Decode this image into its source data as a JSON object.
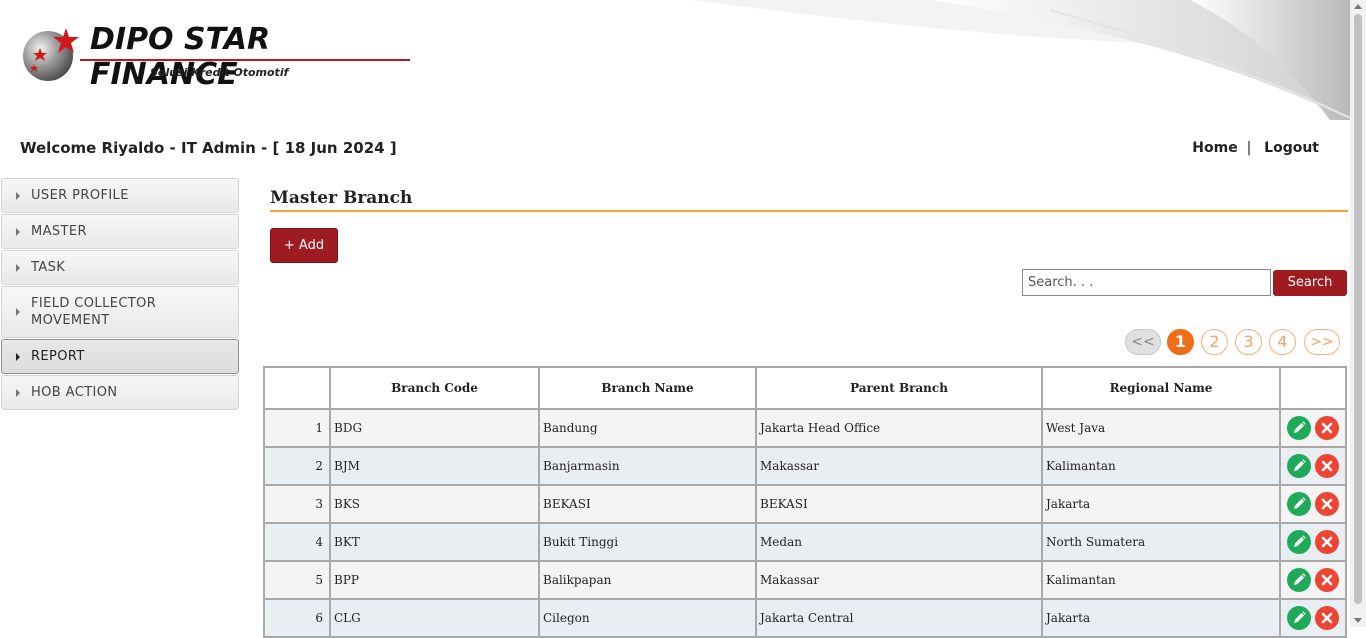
{
  "brand": {
    "name": "DIPO STAR FINANCE",
    "tagline": "Solusi Kredit Otomotif"
  },
  "header": {
    "welcome": "Welcome Riyaldo - IT Admin - [ 18 Jun 2024 ]",
    "links": {
      "home": "Home",
      "separator": "|",
      "logout": "Logout"
    }
  },
  "sidebar": {
    "items": [
      {
        "label": "USER PROFILE"
      },
      {
        "label": "MASTER"
      },
      {
        "label": "TASK"
      },
      {
        "label": "FIELD COLLECTOR MOVEMENT"
      },
      {
        "label": "REPORT"
      },
      {
        "label": "HOB ACTION"
      }
    ],
    "active": "REPORT"
  },
  "main": {
    "title": "Master Branch",
    "add_label": "+ Add",
    "search": {
      "placeholder": "Search. . .",
      "value": "",
      "button": "Search"
    },
    "pagination": {
      "prev": "<<",
      "pages": [
        "1",
        "2",
        "3",
        "4"
      ],
      "current": "1",
      "next": ">>"
    },
    "table": {
      "columns": [
        "",
        "Branch Code",
        "Branch Name",
        "Parent Branch",
        "Regional Name",
        ""
      ],
      "rows": [
        {
          "no": "1",
          "code": "BDG",
          "name": "Bandung",
          "parent": "Jakarta Head Office",
          "regional": "West Java"
        },
        {
          "no": "2",
          "code": "BJM",
          "name": "Banjarmasin",
          "parent": "Makassar",
          "regional": "Kalimantan"
        },
        {
          "no": "3",
          "code": "BKS",
          "name": "BEKASI",
          "parent": "BEKASI",
          "regional": "Jakarta"
        },
        {
          "no": "4",
          "code": "BKT",
          "name": "Bukit Tinggi",
          "parent": "Medan",
          "regional": "North Sumatera"
        },
        {
          "no": "5",
          "code": "BPP",
          "name": "Balikpapan",
          "parent": "Makassar",
          "regional": "Kalimantan"
        },
        {
          "no": "6",
          "code": "CLG",
          "name": "Cilegon",
          "parent": "Jakarta Central",
          "regional": "Jakarta"
        }
      ]
    }
  },
  "colors": {
    "brand_red": "#9e1b21",
    "accent_orange": "#ee6e1a",
    "title_rule": "#f0a830",
    "edit_green": "#1faa5a",
    "delete_red": "#ee4433"
  },
  "icons": {
    "logo": "star-globe-icon",
    "edit": "pencil-icon",
    "delete": "close-icon",
    "menu_arrow": "caret-right-icon"
  }
}
